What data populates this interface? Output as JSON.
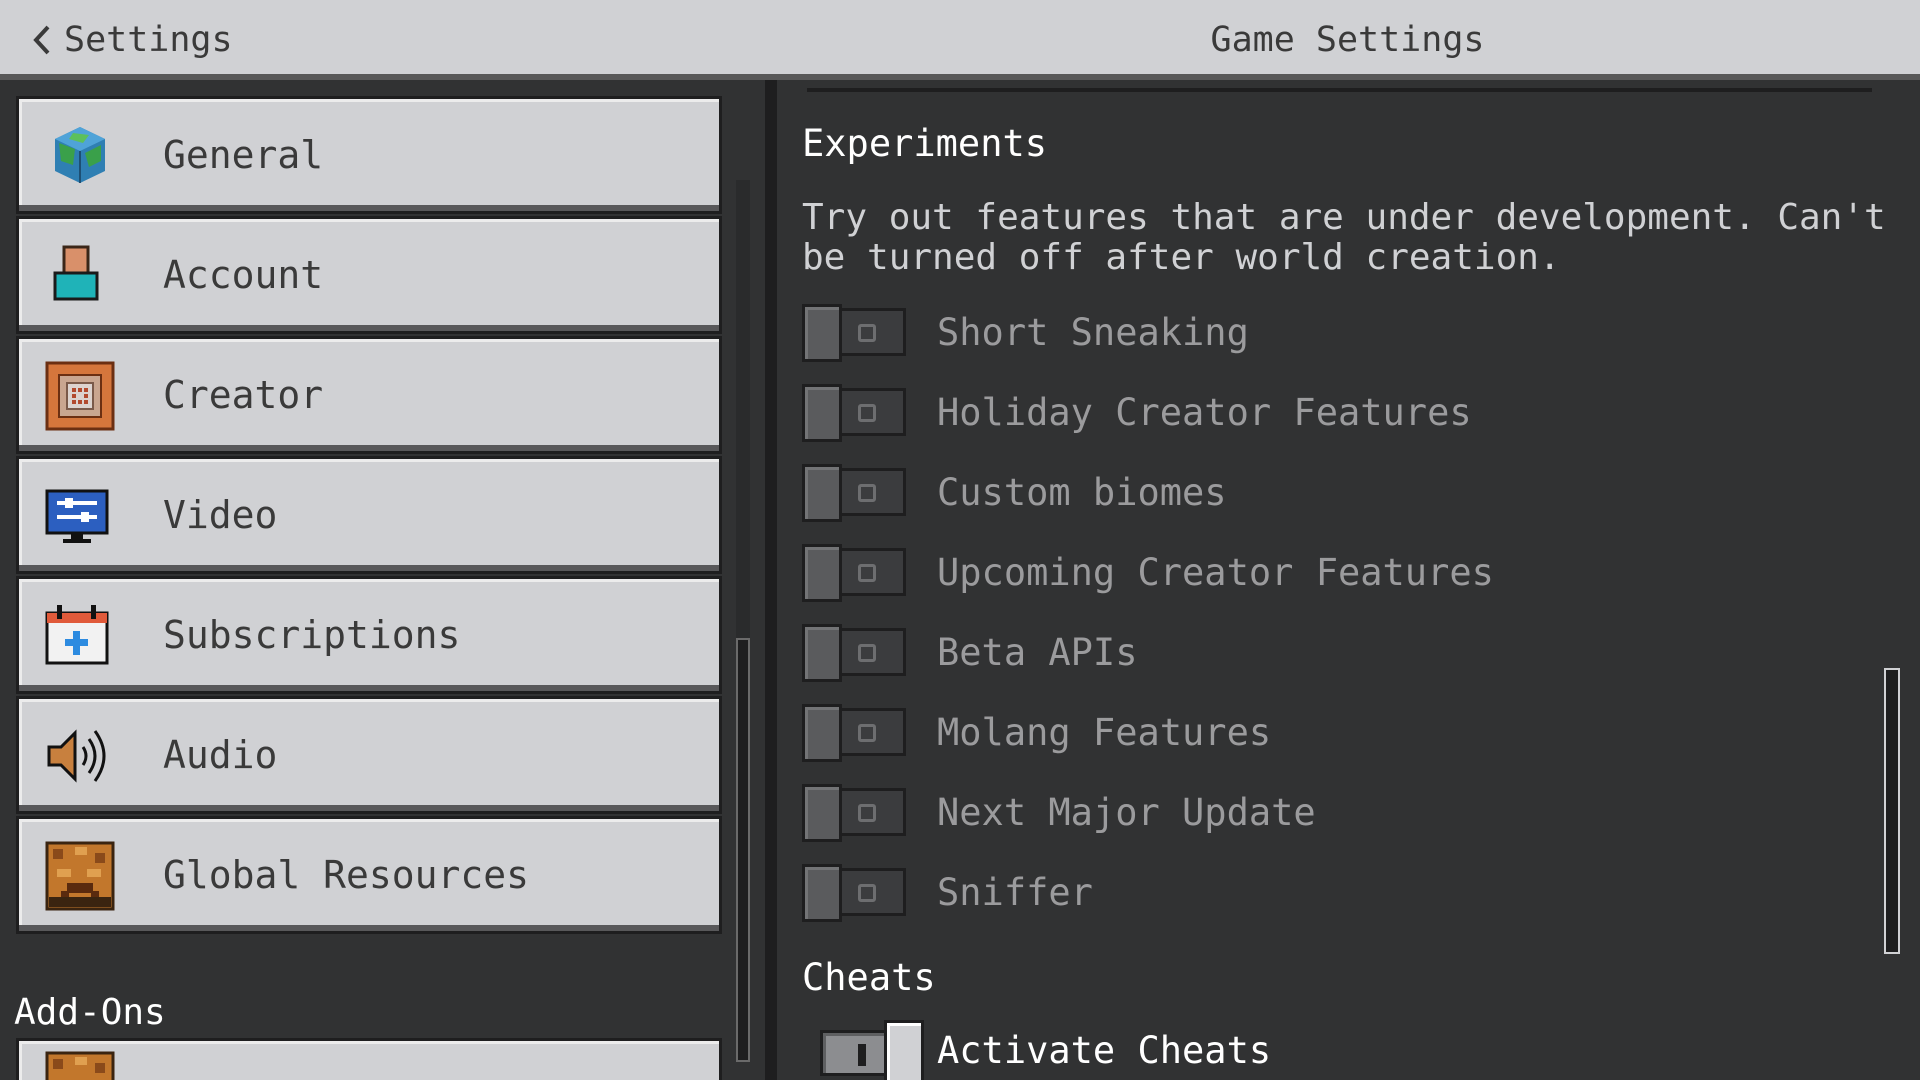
{
  "header": {
    "back_label": "Settings",
    "title": "Game Settings"
  },
  "sidebar": {
    "items": [
      {
        "label": "General",
        "icon": "globe-icon"
      },
      {
        "label": "Account",
        "icon": "account-icon"
      },
      {
        "label": "Creator",
        "icon": "creator-icon"
      },
      {
        "label": "Video",
        "icon": "monitor-icon"
      },
      {
        "label": "Subscriptions",
        "icon": "calendar-plus-icon"
      },
      {
        "label": "Audio",
        "icon": "speaker-icon"
      },
      {
        "label": "Global Resources",
        "icon": "resource-pack-icon"
      }
    ],
    "section_addons": "Add-Ons"
  },
  "experiments": {
    "heading": "Experiments",
    "description": "Try out features that are under development. Can't be turned off after world creation.",
    "toggles": [
      {
        "label": "Short Sneaking",
        "on": false
      },
      {
        "label": "Holiday Creator Features",
        "on": false
      },
      {
        "label": "Custom biomes",
        "on": false
      },
      {
        "label": "Upcoming Creator Features",
        "on": false
      },
      {
        "label": "Beta APIs",
        "on": false
      },
      {
        "label": "Molang Features",
        "on": false
      },
      {
        "label": "Next Major Update",
        "on": false
      },
      {
        "label": "Sniffer",
        "on": false
      }
    ]
  },
  "cheats": {
    "heading": "Cheats",
    "activate_label": "Activate Cheats",
    "activate_on": true
  },
  "colors": {
    "panel_bg": "#313233",
    "button_bg": "#d0d1d4",
    "text_dark": "#3a3a3a",
    "text_disabled": "#9b9b9d"
  }
}
